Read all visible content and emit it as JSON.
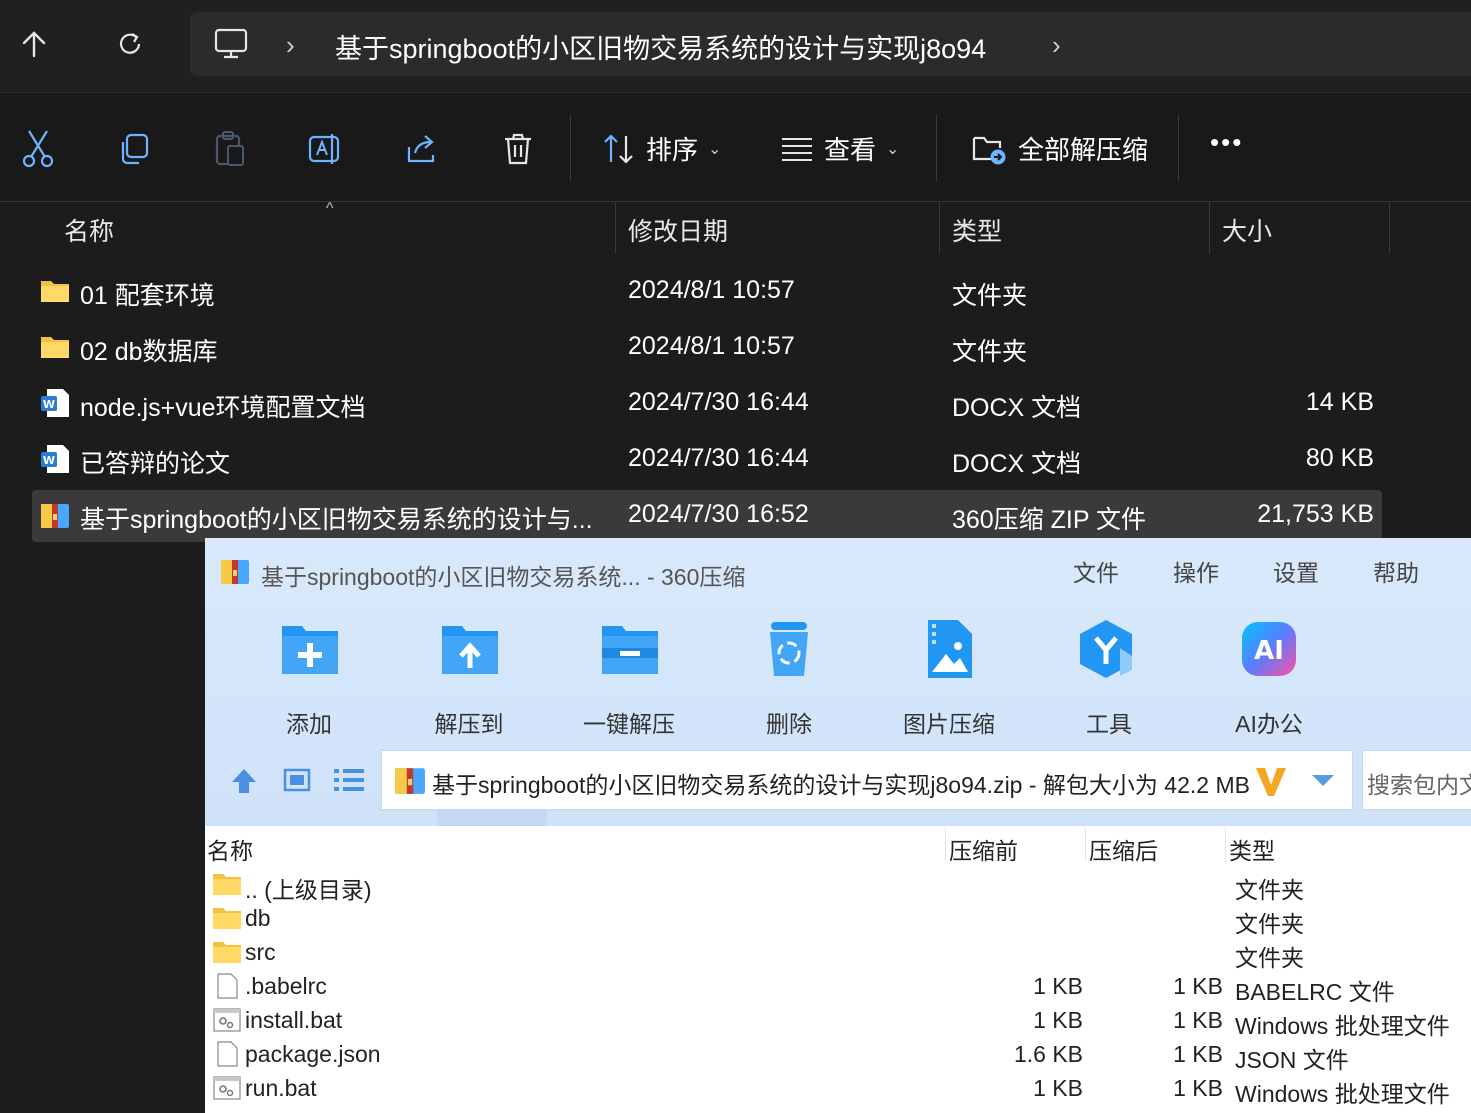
{
  "explorer": {
    "address": {
      "path": "基于springboot的小区旧物交易系统的设计与实现j8o94",
      "chevron": "›"
    },
    "commands": {
      "sort_label": "排序",
      "view_label": "查看",
      "extract_label": "全部解压缩",
      "more_label": "•••",
      "dropdown": "⌄"
    },
    "columns": {
      "name": "名称",
      "modified": "修改日期",
      "type": "类型",
      "size": "大小"
    },
    "files": [
      {
        "name": "01 配套环境",
        "modified": "2024/8/1 10:57",
        "type": "文件夹",
        "size": "",
        "icon": "folder-icon"
      },
      {
        "name": "02 db数据库",
        "modified": "2024/8/1 10:57",
        "type": "文件夹",
        "size": "",
        "icon": "folder-icon"
      },
      {
        "name": "node.js+vue环境配置文档",
        "modified": "2024/7/30 16:44",
        "type": "DOCX 文档",
        "size": "14 KB",
        "icon": "word-doc-icon"
      },
      {
        "name": "已答辩的论文",
        "modified": "2024/7/30 16:44",
        "type": "DOCX 文档",
        "size": "80 KB",
        "icon": "word-doc-icon"
      },
      {
        "name": "基于springboot的小区旧物交易系统的设计与...",
        "modified": "2024/7/30 16:52",
        "type": "360压缩 ZIP 文件",
        "size": "21,753 KB",
        "icon": "zip-archive-icon"
      }
    ]
  },
  "zip_window": {
    "title": "基于springboot的小区旧物交易系统... - 360压缩",
    "menu": [
      "文件",
      "操作",
      "设置",
      "帮助"
    ],
    "tools": [
      "添加",
      "解压到",
      "一键解压",
      "删除",
      "图片压缩",
      "工具",
      "AI办公"
    ],
    "path_text": "基于springboot的小区旧物交易系统的设计与实现j8o94.zip - 解包大小为 42.2 MB",
    "search_placeholder": "搜索包内文",
    "columns": {
      "name": "名称",
      "before": "压缩前",
      "after": "压缩后",
      "type": "类型"
    },
    "entries": [
      {
        "name": ".. (上级目录)",
        "before": "",
        "after": "",
        "type": "文件夹",
        "icon": "folder-icon"
      },
      {
        "name": "db",
        "before": "",
        "after": "",
        "type": "文件夹",
        "icon": "folder-icon"
      },
      {
        "name": "src",
        "before": "",
        "after": "",
        "type": "文件夹",
        "icon": "folder-icon"
      },
      {
        "name": ".babelrc",
        "before": "1 KB",
        "after": "1 KB",
        "type": "BABELRC 文件",
        "icon": "file-icon"
      },
      {
        "name": "install.bat",
        "before": "1 KB",
        "after": "1 KB",
        "type": "Windows 批处理文件",
        "icon": "batch-file-icon"
      },
      {
        "name": "package.json",
        "before": "1.6 KB",
        "after": "1 KB",
        "type": "JSON 文件",
        "icon": "file-icon"
      },
      {
        "name": "run.bat",
        "before": "1 KB",
        "after": "1 KB",
        "type": "Windows 批处理文件",
        "icon": "batch-file-icon"
      }
    ]
  }
}
